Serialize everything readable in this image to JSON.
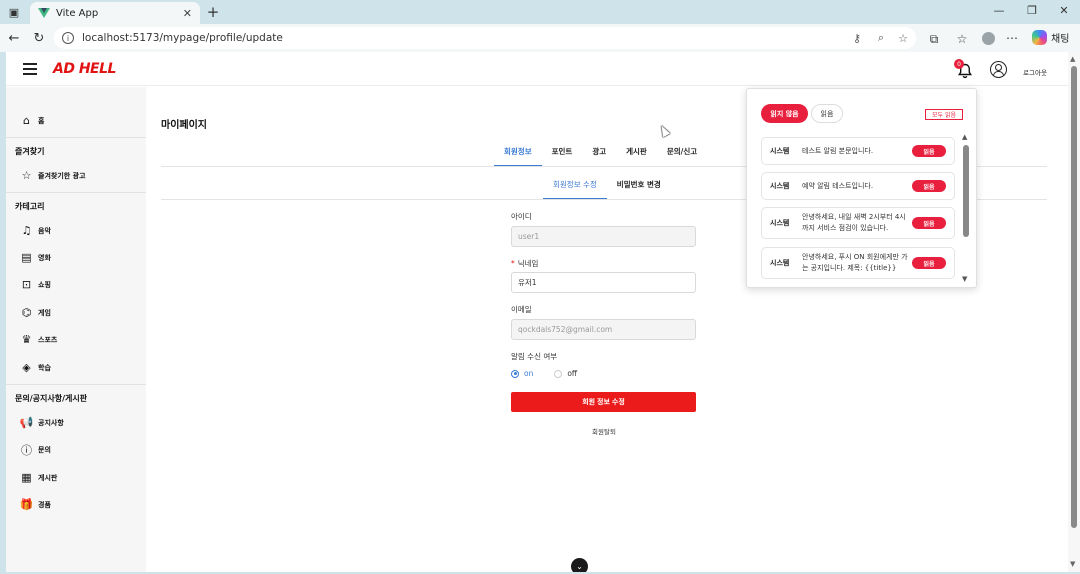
{
  "browser": {
    "tab_title": "Vite App",
    "url": "localhost:5173/mypage/profile/update",
    "copilot_label": "채팅"
  },
  "header": {
    "logo": "AD HELL",
    "notification_count": "0",
    "logout_label": "로그아웃"
  },
  "sidebar": {
    "home": "홈",
    "favorites_heading": "즐겨찾기",
    "favorite_ads": "즐겨찾기한 광고",
    "category_heading": "카테고리",
    "categories": [
      "음악",
      "영화",
      "쇼핑",
      "게임",
      "스포츠",
      "학습"
    ],
    "board_heading": "문의/공지사항/게시판",
    "boards": [
      "공지사항",
      "문의",
      "게시판",
      "경품"
    ]
  },
  "page": {
    "title": "마이페이지",
    "tabs": [
      "회원정보",
      "포인트",
      "광고",
      "게시판",
      "문의/신고"
    ],
    "active_tab": "회원정보",
    "sub_tabs": [
      "회원정보 수정",
      "비밀번호 변경"
    ],
    "active_sub_tab": "회원정보 수정"
  },
  "form": {
    "id_label": "아이디",
    "id_value": "user1",
    "nickname_required": "*",
    "nickname_label": "닉네임",
    "nickname_value": "유저1",
    "email_label": "이메일",
    "email_value": "qockdals752@gmail.com",
    "alarm_label": "알림 수신 여부",
    "alarm_on": "on",
    "alarm_off": "off",
    "alarm_selected": "on",
    "submit_label": "회원 정보 수정",
    "withdraw_label": "회원탈퇴"
  },
  "notifications": {
    "filter_unread": "읽지 않음",
    "filter_read": "읽음",
    "mark_all_read": "모두 읽음",
    "items": [
      {
        "type": "시스템",
        "text": "테스트 알림 본문입니다.",
        "action": "읽음"
      },
      {
        "type": "시스템",
        "text": "예약 알림 테스트입니다.",
        "action": "읽음"
      },
      {
        "type": "시스템",
        "text": "안녕하세요, 내일 새벽 2시부터 4시까지 서비스 점검이 있습니다.",
        "action": "읽음"
      },
      {
        "type": "시스템",
        "text": "안녕하세요, 푸시 ON 회원에게만 가는 공지입니다. 제목: {{title}}",
        "action": "읽음"
      }
    ]
  },
  "colors": {
    "brand_red": "#e11414",
    "accent_blue": "#3a7bd5",
    "badge_red": "#e8203d"
  }
}
